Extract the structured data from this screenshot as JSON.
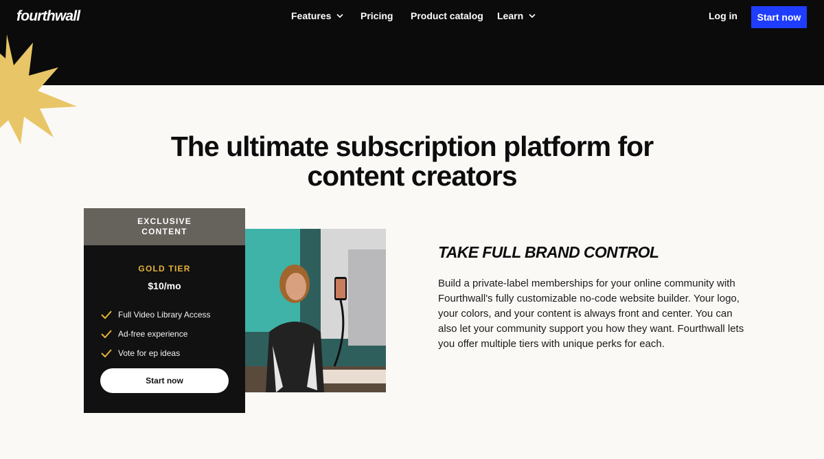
{
  "header": {
    "logo": "fourthwall",
    "nav": [
      {
        "label": "Features",
        "has_dropdown": true
      },
      {
        "label": "Pricing",
        "has_dropdown": false
      },
      {
        "label": "Product catalog",
        "has_dropdown": false
      },
      {
        "label": "Learn",
        "has_dropdown": true
      }
    ],
    "login_label": "Log in",
    "start_label": "Start now",
    "accent_color": "#1f3dff"
  },
  "hero": {
    "title_line1": "The ultimate subscription platform for",
    "title_line2": "content creators"
  },
  "card": {
    "header_line1": "EXCLUSIVE",
    "header_line2": "CONTENT",
    "tier": "GOLD TIER",
    "price": "$10/mo",
    "perks": [
      "Full Video Library Access",
      "Ad-free experience",
      "Vote for ep ideas"
    ],
    "button_label": "Start now",
    "tier_color": "#e6b43a"
  },
  "feature": {
    "title": "TAKE FULL BRAND CONTROL",
    "body": "Build a private-label memberships for your online community with Fourthwall's fully customizable no-code website builder. Your logo, your colors, and your content is always front and center. You can also let your community support you how they want. Fourthwall lets you offer multiple tiers with unique perks for each."
  },
  "icons": [
    "chevron-down-icon",
    "check-icon",
    "starburst-decoration"
  ]
}
